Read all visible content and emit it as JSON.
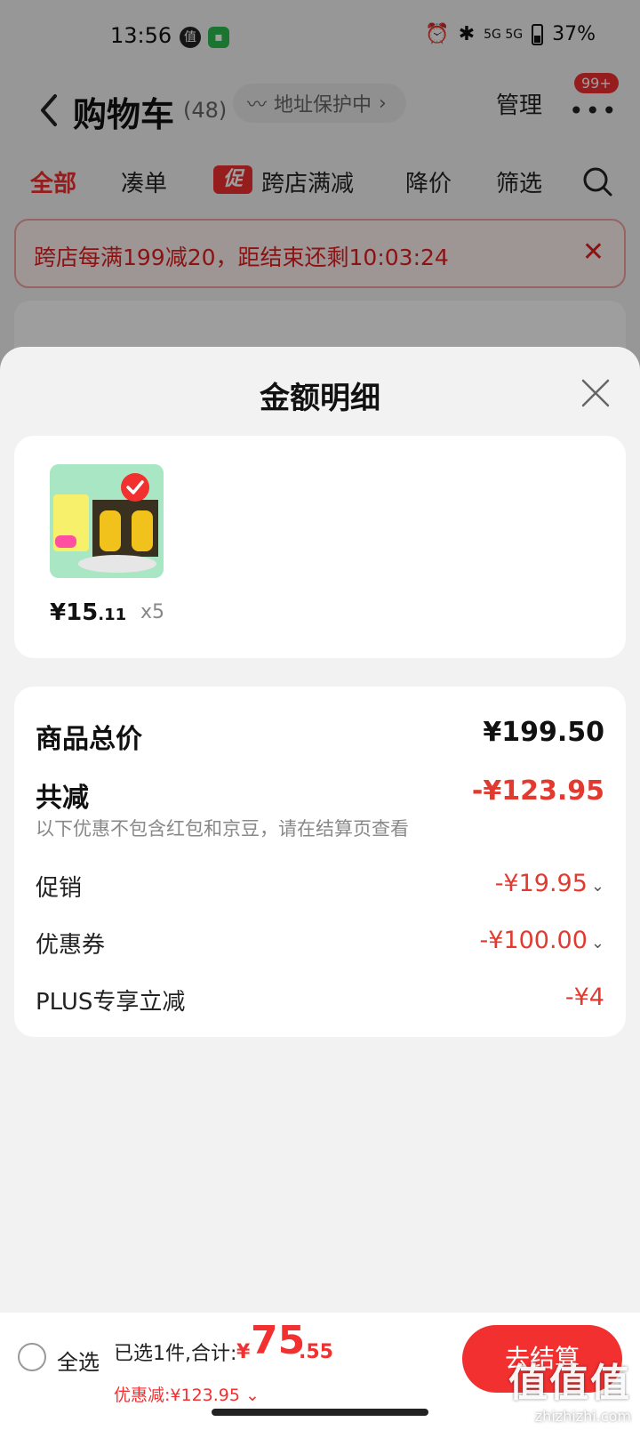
{
  "status_bar": {
    "time": "13:56",
    "app_icons": [
      "值",
      "消息"
    ],
    "network": "5G 5G",
    "battery": "37%"
  },
  "cart_header": {
    "title": "购物车",
    "count": "(48)",
    "address_protect": "地址保护中",
    "manage": "管理",
    "badge": "99+"
  },
  "filter_tabs": {
    "all": "全部",
    "combo": "凑单",
    "promo_tag": "促",
    "cross_store": "跨店满减",
    "price_drop": "降价",
    "filter": "筛选"
  },
  "promo_banner": {
    "text": "跨店每满199减20，距结束还剩10:03:24"
  },
  "sheet": {
    "title": "金额明细",
    "product": {
      "price_symbol": "¥",
      "price_int": "15",
      "price_dec": ".11",
      "qty": "x5"
    },
    "summary": {
      "total_label": "商品总价",
      "total_value": "¥199.50",
      "reduce_label": "共减",
      "reduce_value": "-¥123.95",
      "reduce_note": "以下优惠不包含红包和京豆，请在结算页查看",
      "promo_label": "促销",
      "promo_value": "-¥19.95",
      "coupon_label": "优惠券",
      "coupon_value": "-¥100.00",
      "plus_label": "PLUS专享立减",
      "plus_value": "-¥4"
    }
  },
  "bottom_bar": {
    "select_all": "全选",
    "selected_text": "已选1件,合计:",
    "total_symbol": "¥",
    "total_int": "75",
    "total_dec": ".55",
    "discount_text": "优惠减:¥123.95",
    "checkout": "去结算"
  },
  "watermark": {
    "big": "值值值",
    "small": "zhizhizhi.com"
  },
  "colors": {
    "accent_red": "#f23030",
    "discount_red": "#e23a2e",
    "sheet_bg": "#f2f2f2"
  }
}
